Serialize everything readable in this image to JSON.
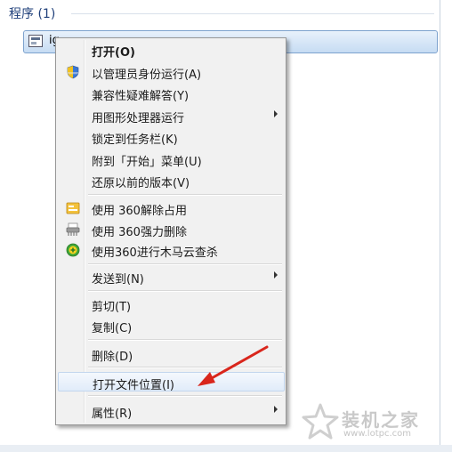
{
  "start_menu": {
    "group_header": "程序 (1)",
    "program_name": "ig"
  },
  "menu": {
    "items": [
      {
        "label": "打开(O)",
        "bold": true,
        "icon": ""
      },
      {
        "label": "以管理员身份运行(A)",
        "icon": "shield-icon"
      },
      {
        "label": "兼容性疑难解答(Y)",
        "icon": ""
      },
      {
        "label": "用图形处理器运行",
        "icon": "",
        "submenu": true
      },
      {
        "label": "锁定到任务栏(K)",
        "icon": ""
      },
      {
        "label": "附到「开始」菜单(U)",
        "icon": ""
      },
      {
        "label": "还原以前的版本(V)",
        "icon": ""
      },
      {
        "label": "使用 360解除占用",
        "icon": "unlock-360-icon"
      },
      {
        "label": "使用 360强力删除",
        "icon": "shredder-360-icon"
      },
      {
        "label": "使用360进行木马云查杀",
        "icon": "scan-360-icon"
      },
      {
        "label": "发送到(N)",
        "icon": "",
        "submenu": true
      },
      {
        "label": "剪切(T)",
        "icon": ""
      },
      {
        "label": "复制(C)",
        "icon": ""
      },
      {
        "label": "删除(D)",
        "icon": ""
      },
      {
        "label": "打开文件位置(I)",
        "icon": "",
        "highlighted": true
      },
      {
        "label": "属性(R)",
        "icon": "",
        "submenu": true
      }
    ]
  },
  "annotation": {
    "arrow_color": "#d9261c"
  },
  "watermark": {
    "title": "装机之家",
    "url": "www.lotpc.com"
  }
}
